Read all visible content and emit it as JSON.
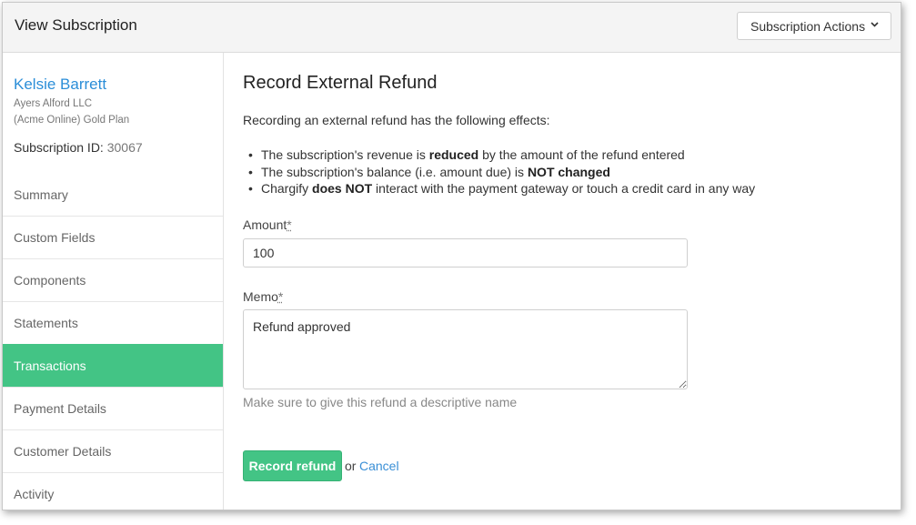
{
  "header": {
    "title": "View Subscription",
    "actions_label": "Subscription Actions"
  },
  "sidebar": {
    "customer_name": "Kelsie Barrett",
    "company": "Ayers Alford LLC",
    "plan": "(Acme Online) Gold Plan",
    "subscription_id_label": "Subscription ID:",
    "subscription_id": "30067",
    "items": [
      {
        "label": "Summary"
      },
      {
        "label": "Custom Fields"
      },
      {
        "label": "Components"
      },
      {
        "label": "Statements"
      },
      {
        "label": "Transactions",
        "active": true
      },
      {
        "label": "Payment Details"
      },
      {
        "label": "Customer Details"
      },
      {
        "label": "Activity"
      }
    ]
  },
  "main": {
    "title": "Record External Refund",
    "intro": "Recording an external refund has the following effects:",
    "effects": [
      {
        "pre": "The subscription's revenue is ",
        "bold": "reduced",
        "post": " by the amount of the refund entered"
      },
      {
        "pre": "The subscription's balance (i.e. amount due) is ",
        "bold": "NOT changed",
        "post": ""
      },
      {
        "pre": "Chargify ",
        "bold": "does NOT",
        "post": " interact with the payment gateway or touch a credit card in any way"
      }
    ],
    "amount_label": "Amount",
    "amount_required": "*",
    "amount_value": "100",
    "memo_label": "Memo",
    "memo_required": "*",
    "memo_value": "Refund approved",
    "memo_hint": "Make sure to give this refund a descriptive name",
    "record_button": "Record refund",
    "or_text": "or",
    "cancel_link": "Cancel"
  },
  "colors": {
    "accent_green": "#43c485",
    "link_blue": "#2b8ed8"
  },
  "icons": {
    "actions_dropdown": "chevron-down-icon"
  }
}
